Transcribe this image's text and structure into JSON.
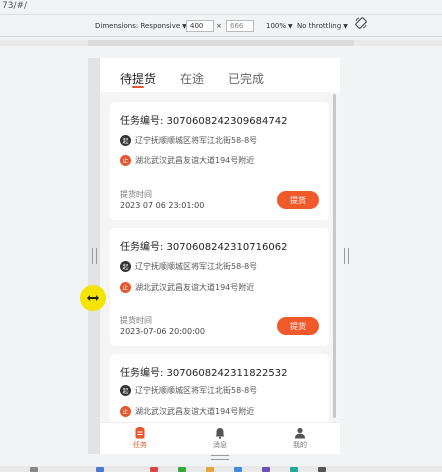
{
  "browser": {
    "url_fragment": "73/#/"
  },
  "devtools": {
    "dimensions_label": "Dimensions: Responsive",
    "width_value": "400",
    "times": "×",
    "height_value": "666",
    "zoom_label": "100%",
    "throttle_label": "No throttling",
    "rotate_icon": "rotate-icon"
  },
  "tabs": [
    {
      "label": "待提货"
    },
    {
      "label": "在途"
    },
    {
      "label": "已完成"
    }
  ],
  "orders": [
    {
      "title": "任务编号: 3070608242309684742",
      "start_badge": "起",
      "start_address": "辽宁抚顺顺城区将军江北街58-8号",
      "end_badge": "止",
      "end_address": "湖北武汉武昌友谊大道194号附近",
      "time_label": "提货时间",
      "time_value": "2023 07 06 23:01:00",
      "button_label": "提货"
    },
    {
      "title": "任务编号: 3070608242310716062",
      "start_badge": "起",
      "start_address": "辽宁抚顺顺城区将军江北街58-8号",
      "end_badge": "止",
      "end_address": "湖北武汉武昌友谊大道194号附近",
      "time_label": "提货时间",
      "time_value": "2023-07-06 20:00:00",
      "button_label": "提货"
    },
    {
      "title": "任务编号: 3070608242311822532",
      "start_badge": "起",
      "start_address": "辽宁抚顺顺城区将军江北街58-8号",
      "end_badge": "止",
      "end_address": "湖北武汉武昌友谊大道194号附近"
    }
  ],
  "bottom_nav": [
    {
      "label": "任务",
      "icon": "task-list-icon"
    },
    {
      "label": "消息",
      "icon": "bell-icon"
    },
    {
      "label": "我的",
      "icon": "user-icon"
    }
  ],
  "colors": {
    "accent": "#e4572e",
    "button": "#f05a2b",
    "cursor": "#f5e400"
  }
}
